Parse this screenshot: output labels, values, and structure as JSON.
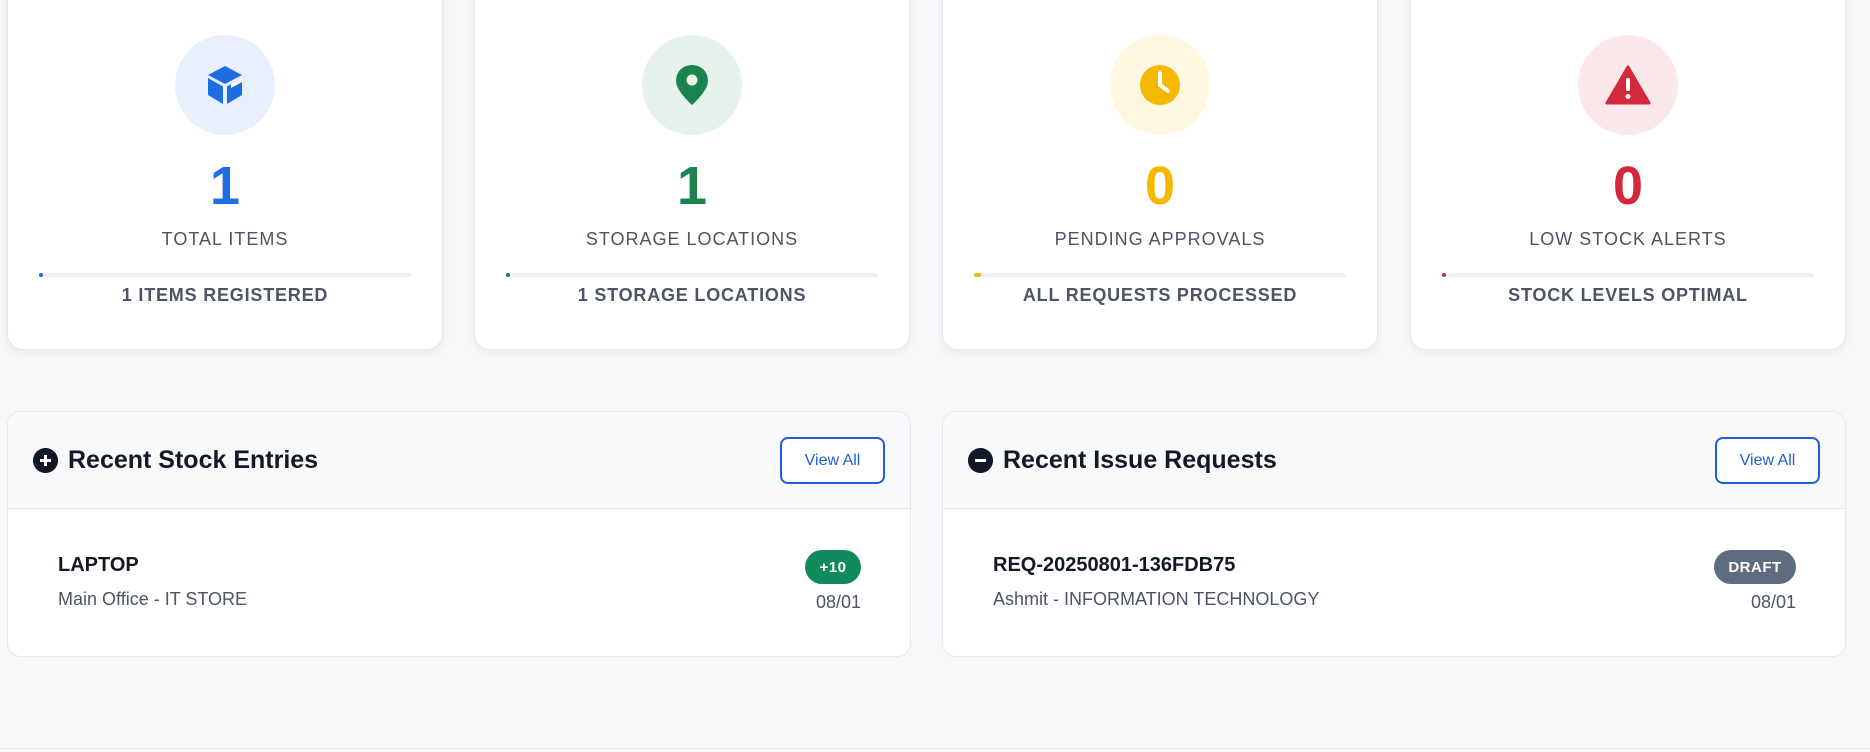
{
  "stats": [
    {
      "value": "1",
      "label": "TOTAL ITEMS",
      "subtitle": "1 ITEMS REGISTERED",
      "icon": "cube-icon",
      "color": "#1d6fe0",
      "bg": "#e8f0fe",
      "progress": 0.01
    },
    {
      "value": "1",
      "label": "STORAGE LOCATIONS",
      "subtitle": "1 STORAGE LOCATIONS",
      "icon": "map-pin-icon",
      "color": "#1a8350",
      "bg": "#e6f2ec",
      "progress": 0.01
    },
    {
      "value": "0",
      "label": "PENDING APPROVALS",
      "subtitle": "ALL REQUESTS PROCESSED",
      "icon": "clock-icon",
      "color": "#f5b800",
      "bg": "#fff7e0",
      "progress": 0.01
    },
    {
      "value": "0",
      "label": "LOW STOCK ALERTS",
      "subtitle": "STOCK LEVELS OPTIMAL",
      "icon": "warning-icon",
      "color": "#d4283c",
      "bg": "#fbe8ea",
      "progress": 0.01
    }
  ],
  "panels": {
    "stock": {
      "title": "Recent Stock Entries",
      "button": "View All",
      "icon": "plus-circle-icon",
      "entry": {
        "title": "LAPTOP",
        "subtitle": "Main Office - IT STORE",
        "badge": "+10",
        "badge_color": "#128a5c",
        "date": "08/01"
      }
    },
    "issue": {
      "title": "Recent Issue Requests",
      "button": "View All",
      "icon": "minus-circle-icon",
      "entry": {
        "title": "REQ-20250801-136FDB75",
        "subtitle": "Ashmit - INFORMATION TECHNOLOGY",
        "badge": "DRAFT",
        "badge_color": "#5f6b7e",
        "date": "08/01"
      }
    }
  }
}
